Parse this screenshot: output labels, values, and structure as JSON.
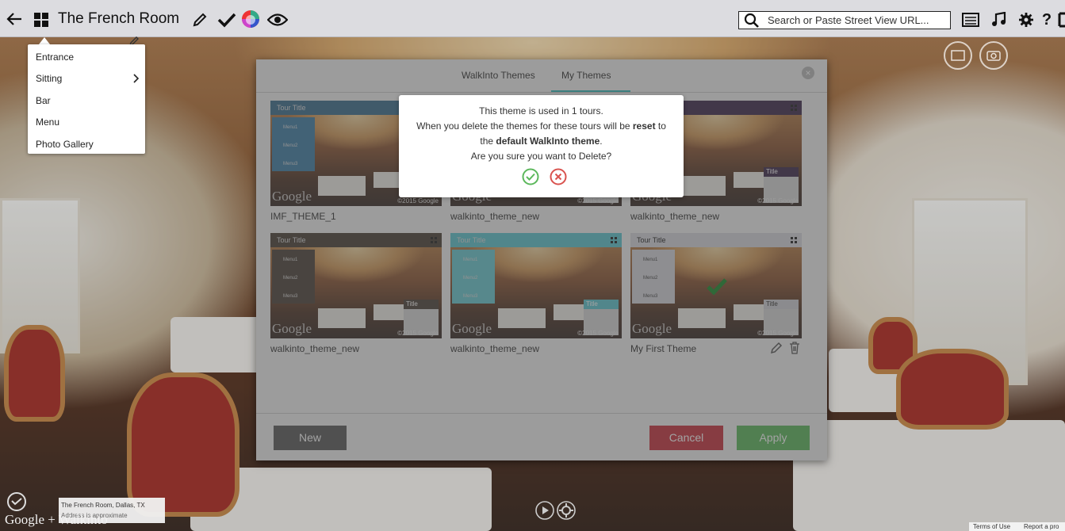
{
  "header": {
    "title": "The French Room",
    "search_placeholder": "Search or Paste Street View URL..."
  },
  "scene_menu": {
    "items": [
      {
        "label": "Entrance"
      },
      {
        "label": "Sitting"
      },
      {
        "label": "Bar"
      },
      {
        "label": "Menu"
      },
      {
        "label": "Photo Gallery"
      }
    ]
  },
  "themes_dialog": {
    "tabs": [
      "WalkInto Themes",
      "My Themes"
    ],
    "active_tab": "My Themes",
    "themes": [
      {
        "name": "IMF_THEME_1",
        "header_color": "#3a6e8f",
        "menu_color": "#3f7fa7",
        "title_color": "",
        "show_title_box": false
      },
      {
        "name": "walkinto_theme_new",
        "header_color": "#4a4a4a",
        "menu_color": "#5a5a5a",
        "title_color": "#555555",
        "show_title_box": true
      },
      {
        "name": "walkinto_theme_new",
        "header_color": "#3f2a4d",
        "menu_color": "",
        "title_color": "#3f2a4d",
        "show_title_box": true
      },
      {
        "name": "walkinto_theme_new",
        "header_color": "#4a4036",
        "menu_color": "#4d433a",
        "title_color": "#4d433a",
        "show_title_box": true
      },
      {
        "name": "walkinto_theme_new",
        "header_color": "#5cc6d0",
        "menu_color": "#69cbd3",
        "title_color": "#5cc6d0",
        "show_title_box": true
      },
      {
        "name": "My First Theme",
        "header_color": "#d8d8de",
        "menu_color": "#d6d6dc",
        "title_color": "#d0d0d6",
        "show_title_box": true,
        "selected": true
      }
    ],
    "theme_labels": {
      "tour_title": "Tour Title",
      "menu1": "Menu1",
      "menu2": "Menu2",
      "menu3": "Menu3",
      "title": "Title",
      "google": "Google",
      "copyright": "©2015 Google"
    },
    "buttons": {
      "new": "New",
      "cancel": "Cancel",
      "apply": "Apply"
    },
    "button_colors": {
      "new": "#5a5a5a",
      "cancel": "#c9323f",
      "apply": "#5cb85c"
    }
  },
  "confirm_dialog": {
    "line1": "This theme is used in 1 tours.",
    "line2_prefix": "When you delete the themes for these tours will be ",
    "line2_bold": "reset",
    "line2_suffix": " to",
    "line3_prefix": "the ",
    "line3_bold": "default WalkInto theme",
    "line3_suffix": ".",
    "line4": "Are you sure you want to Delete?",
    "confirm_color": "#5cb85c",
    "cancel_color": "#d9534f"
  },
  "map_attribution": {
    "place": "The French Room, Dallas, TX",
    "note": "Address is approximate",
    "brand": "Google + Walkinto"
  },
  "footer_links": {
    "terms": "Terms of Use",
    "report": "Report a pro"
  }
}
